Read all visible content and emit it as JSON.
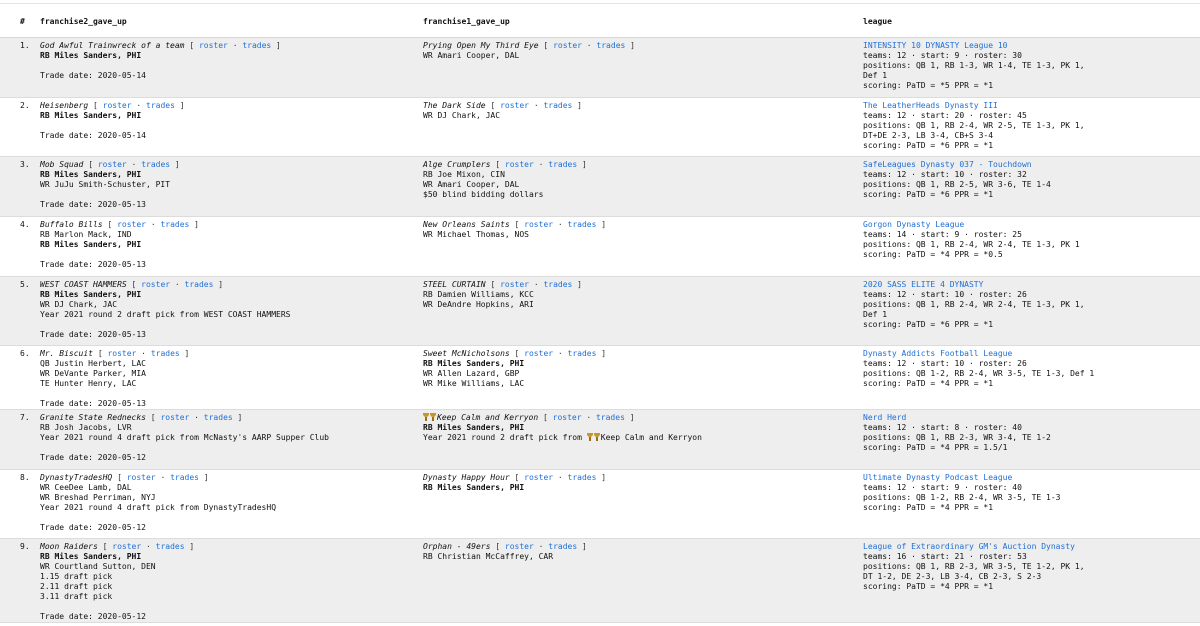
{
  "headers": {
    "num": "#",
    "f2": "franchise2_gave_up",
    "f1": "franchise1_gave_up",
    "league": "league"
  },
  "links": {
    "roster": "roster",
    "trades": "trades",
    "sep": " · ",
    "open": "[ ",
    "close": " ]"
  },
  "colors": {
    "link": "#1f6fd6",
    "row_alt": "#eeeeee"
  },
  "rows": [
    {
      "num": "1.",
      "f2": {
        "team": "God Awful Trainwreck of a team",
        "assets": [
          {
            "t": "RB Miles Sanders, PHI",
            "b": true
          }
        ],
        "date": "Trade date: 2020-05-14"
      },
      "f1": {
        "team": "Prying Open My Third Eye",
        "assets": [
          {
            "t": "WR Amari Cooper, DAL",
            "b": false
          }
        ]
      },
      "league": {
        "name": "INTENSITY 10 DYNASTY League 10",
        "lines": [
          "teams: 12 · start: 9 · roster: 30",
          "positions: QB 1, RB 1-3, WR 1-4, TE 1-3, PK 1,",
          "Def 1",
          "scoring: PaTD = *5 PPR = *1"
        ]
      }
    },
    {
      "num": "2.",
      "f2": {
        "team": "Heisenberg",
        "assets": [
          {
            "t": "RB Miles Sanders, PHI",
            "b": true
          }
        ],
        "date": "Trade date: 2020-05-14"
      },
      "f1": {
        "team": "The Dark Side",
        "assets": [
          {
            "t": "WR DJ Chark, JAC",
            "b": false
          }
        ]
      },
      "league": {
        "name": "The LeatherHeads Dynasty III",
        "lines": [
          "teams: 12 · start: 20 · roster: 45",
          "positions: QB 1, RB 2-4, WR 2-5, TE 1-3, PK 1,",
          "DT+DE 2-3, LB 3-4, CB+S 3-4",
          "scoring: PaTD = *6 PPR = *1"
        ]
      }
    },
    {
      "num": "3.",
      "f2": {
        "team": "Mob Squad",
        "assets": [
          {
            "t": "RB Miles Sanders, PHI",
            "b": true
          },
          {
            "t": "WR JuJu Smith-Schuster, PIT",
            "b": false
          }
        ],
        "date": "Trade date: 2020-05-13"
      },
      "f1": {
        "team": "Alge Crumplers",
        "assets": [
          {
            "t": "RB Joe Mixon, CIN",
            "b": false
          },
          {
            "t": "WR Amari Cooper, DAL",
            "b": false
          },
          {
            "t": "$50 blind bidding dollars",
            "b": false
          }
        ]
      },
      "league": {
        "name": "SafeLeagues Dynasty 037 - Touchdown",
        "lines": [
          "teams: 12 · start: 10 · roster: 32",
          "positions: QB 1, RB 2-5, WR 3-6, TE 1-4",
          "scoring: PaTD = *6 PPR = *1"
        ]
      }
    },
    {
      "num": "4.",
      "f2": {
        "team": "Buffalo Bills",
        "assets": [
          {
            "t": "RB Marlon Mack, IND",
            "b": false
          },
          {
            "t": "RB Miles Sanders, PHI",
            "b": true
          }
        ],
        "date": "Trade date: 2020-05-13"
      },
      "f1": {
        "team": "New Orleans Saints",
        "assets": [
          {
            "t": "WR Michael Thomas, NOS",
            "b": false
          }
        ]
      },
      "league": {
        "name": "Gorgon Dynasty League",
        "lines": [
          "teams: 14 · start: 9 · roster: 25",
          "positions: QB 1, RB 2-4, WR 2-4, TE 1-3, PK 1",
          "scoring: PaTD = *4 PPR = *0.5"
        ]
      }
    },
    {
      "num": "5.",
      "f2": {
        "team": "WEST COAST HAMMERS",
        "assets": [
          {
            "t": "RB Miles Sanders, PHI",
            "b": true
          },
          {
            "t": "WR DJ Chark, JAC",
            "b": false
          },
          {
            "t": "Year 2021 round 2 draft pick from WEST COAST HAMMERS",
            "b": false
          }
        ],
        "date": "Trade date: 2020-05-13"
      },
      "f1": {
        "team": "STEEL CURTAIN",
        "assets": [
          {
            "t": "RB Damien Williams, KCC",
            "b": false
          },
          {
            "t": "WR DeAndre Hopkins, ARI",
            "b": false
          }
        ]
      },
      "league": {
        "name": "2020 SASS ELITE 4 DYNASTY",
        "lines": [
          "teams: 12 · start: 10 · roster: 26",
          "positions: QB 1, RB 2-4, WR 2-4, TE 1-3, PK 1,",
          "Def 1",
          "scoring: PaTD = *6 PPR = *1"
        ]
      }
    },
    {
      "num": "6.",
      "f2": {
        "team": "Mr. Biscuit",
        "assets": [
          {
            "t": "QB Justin Herbert, LAC",
            "b": false
          },
          {
            "t": "WR DeVante Parker, MIA",
            "b": false
          },
          {
            "t": "TE Hunter Henry, LAC",
            "b": false
          }
        ],
        "date": "Trade date: 2020-05-13"
      },
      "f1": {
        "team": "Sweet McNicholsons",
        "assets": [
          {
            "t": "RB Miles Sanders, PHI",
            "b": true
          },
          {
            "t": "WR Allen Lazard, GBP",
            "b": false
          },
          {
            "t": "WR Mike Williams, LAC",
            "b": false
          }
        ]
      },
      "league": {
        "name": "Dynasty Addicts Football League",
        "lines": [
          "teams: 12 · start: 10 · roster: 26",
          "positions: QB 1-2, RB 2-4, WR 3-5, TE 1-3, Def 1",
          "scoring: PaTD = *4 PPR = *1"
        ]
      }
    },
    {
      "num": "7.",
      "f2": {
        "team": "Granite State Rednecks",
        "assets": [
          {
            "t": "RB Josh Jacobs, LVR",
            "b": false
          },
          {
            "t": "Year 2021 round 4 draft pick from McNasty's AARP Supper Club",
            "b": false
          }
        ],
        "date": "Trade date: 2020-05-12"
      },
      "f1": {
        "team": "Keep Calm and Kerryon",
        "trophy": true,
        "assets": [
          {
            "t": "RB Miles Sanders, PHI",
            "b": true
          }
        ],
        "pick_prefix": "Year 2021 round 2 draft pick from ",
        "pick_team": "Keep Calm and Kerryon"
      },
      "league": {
        "name": "Nerd Herd",
        "lines": [
          "teams: 12 · start: 8 · roster: 40",
          "positions: QB 1, RB 2-3, WR 3-4, TE 1-2",
          "scoring: PaTD = *4 PPR = 1.5/1"
        ]
      }
    },
    {
      "num": "8.",
      "f2": {
        "team": "DynastyTradesHQ",
        "assets": [
          {
            "t": "WR CeeDee Lamb, DAL",
            "b": false
          },
          {
            "t": "WR Breshad Perriman, NYJ",
            "b": false
          },
          {
            "t": "Year 2021 round 4 draft pick from DynastyTradesHQ",
            "b": false
          }
        ],
        "date": "Trade date: 2020-05-12"
      },
      "f1": {
        "team": "Dynasty Happy Hour",
        "assets": [
          {
            "t": "RB Miles Sanders, PHI",
            "b": true
          }
        ]
      },
      "league": {
        "name": "Ultimate Dynasty Podcast League",
        "lines": [
          "teams: 12 · start: 9 · roster: 40",
          "positions: QB 1-2, RB 2-4, WR 3-5, TE 1-3",
          "scoring: PaTD = *4 PPR = *1"
        ]
      }
    },
    {
      "num": "9.",
      "f2": {
        "team": "Moon Raiders",
        "assets": [
          {
            "t": "RB Miles Sanders, PHI",
            "b": true
          },
          {
            "t": "WR Courtland Sutton, DEN",
            "b": false
          },
          {
            "t": "1.15 draft pick",
            "b": false
          },
          {
            "t": "2.11 draft pick",
            "b": false
          },
          {
            "t": "3.11 draft pick",
            "b": false
          }
        ],
        "date": "Trade date: 2020-05-12"
      },
      "f1": {
        "team": "Orphan - 49ers",
        "assets": [
          {
            "t": "RB Christian McCaffrey, CAR",
            "b": false
          }
        ]
      },
      "league": {
        "name": "League of Extraordinary GM's Auction Dynasty",
        "lines": [
          "teams: 16 · start: 21 · roster: 53",
          "positions: QB 1, RB 2-3, WR 3-5, TE 1-2, PK 1,",
          "DT 1-2, DE 2-3, LB 3-4, CB 2-3, S 2-3",
          "scoring: PaTD = *4 PPR = *1"
        ]
      }
    }
  ]
}
